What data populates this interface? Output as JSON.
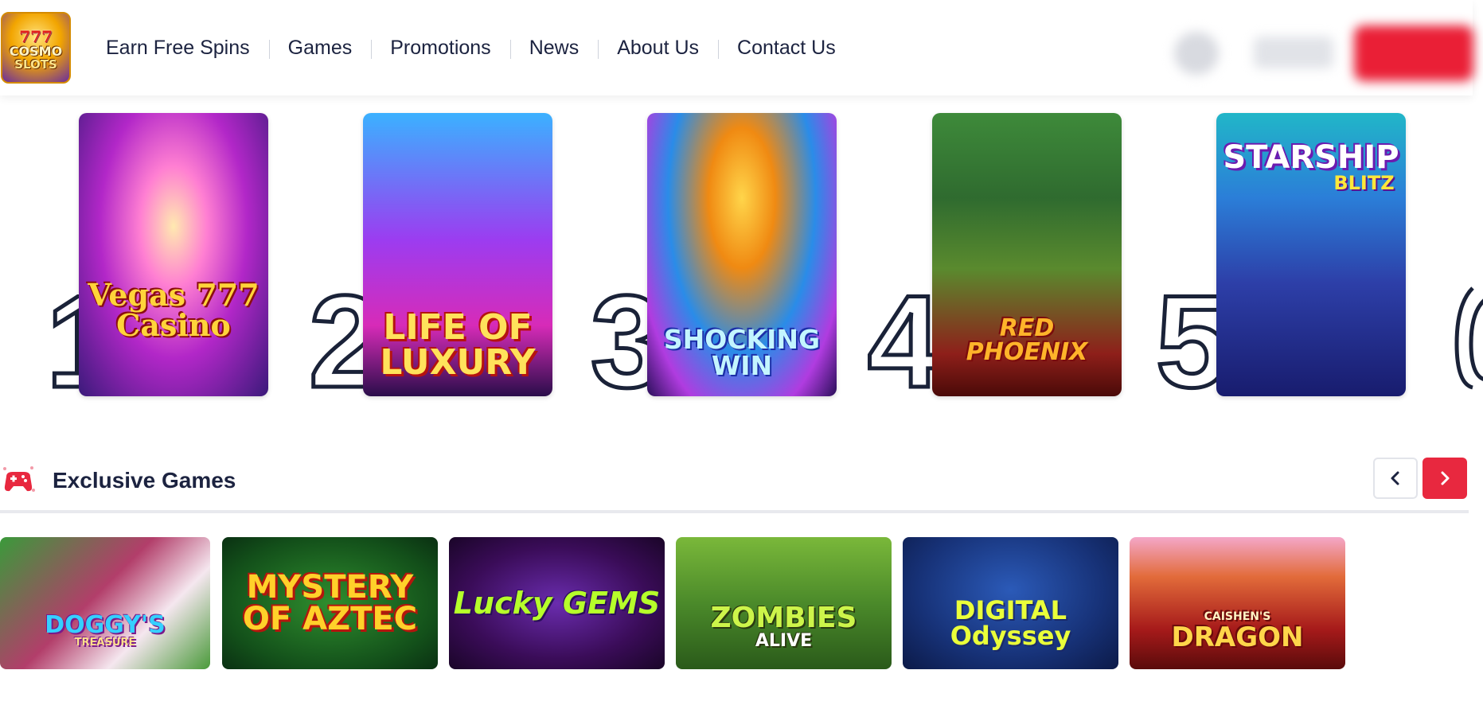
{
  "header": {
    "logo": {
      "line1": "777",
      "line2": "COSMO",
      "line3": "SLOTS"
    },
    "nav": [
      "Earn Free Spins",
      "Games",
      "Promotions",
      "News",
      "About Us",
      "Contact Us"
    ]
  },
  "top_games": [
    {
      "rank": "1",
      "title": "Vegas 777 Casino"
    },
    {
      "rank": "2",
      "title": "LIFE OF LUXURY"
    },
    {
      "rank": "3",
      "title": "SHOCKING WIN"
    },
    {
      "rank": "4",
      "title": "RED PHOENIX"
    },
    {
      "rank": "5",
      "title": "STARSHIP",
      "subtitle": "BLITZ"
    }
  ],
  "exclusive": {
    "title": "Exclusive Games",
    "games": [
      {
        "title": "DOGGY'S",
        "subtitle": "TREASURE"
      },
      {
        "title": "MYSTERY OF AZTEC"
      },
      {
        "title": "Lucky GEMS"
      },
      {
        "title": "ZOMBIES",
        "subtitle": "ALIVE"
      },
      {
        "title": "DIGITAL Odyssey"
      },
      {
        "title": "DRAGON",
        "subtitle": "CAISHEN'S"
      }
    ]
  },
  "colors": {
    "accent": "#e8283f",
    "text": "#1c2340"
  }
}
